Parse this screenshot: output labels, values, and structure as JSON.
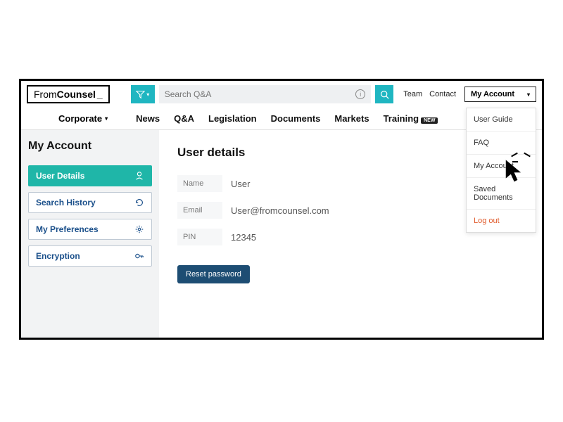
{
  "logo": {
    "part1": "From",
    "part2": "Counsel",
    "cursor": "_"
  },
  "search": {
    "placeholder": "Search Q&A"
  },
  "toplinks": {
    "team": "Team",
    "contact": "Contact"
  },
  "account_button": "My Account",
  "nav": {
    "corporate": "Corporate",
    "items": [
      "News",
      "Q&A",
      "Legislation",
      "Documents",
      "Markets",
      "Training"
    ],
    "new_badge": "NEW"
  },
  "sidebar": {
    "title": "My Account",
    "items": [
      {
        "label": "User Details"
      },
      {
        "label": "Search History"
      },
      {
        "label": "My Preferences"
      },
      {
        "label": "Encryption"
      }
    ]
  },
  "main": {
    "title": "User details",
    "fields": {
      "name_label": "Name",
      "name_value": "User",
      "email_label": "Email",
      "email_value": "User@fromcounsel.com",
      "pin_label": "PIN",
      "pin_value": "12345"
    },
    "reset_button": "Reset password"
  },
  "dropdown": {
    "items": [
      "User Guide",
      "FAQ",
      "My Account",
      "Saved Documents"
    ],
    "logout": "Log out"
  }
}
